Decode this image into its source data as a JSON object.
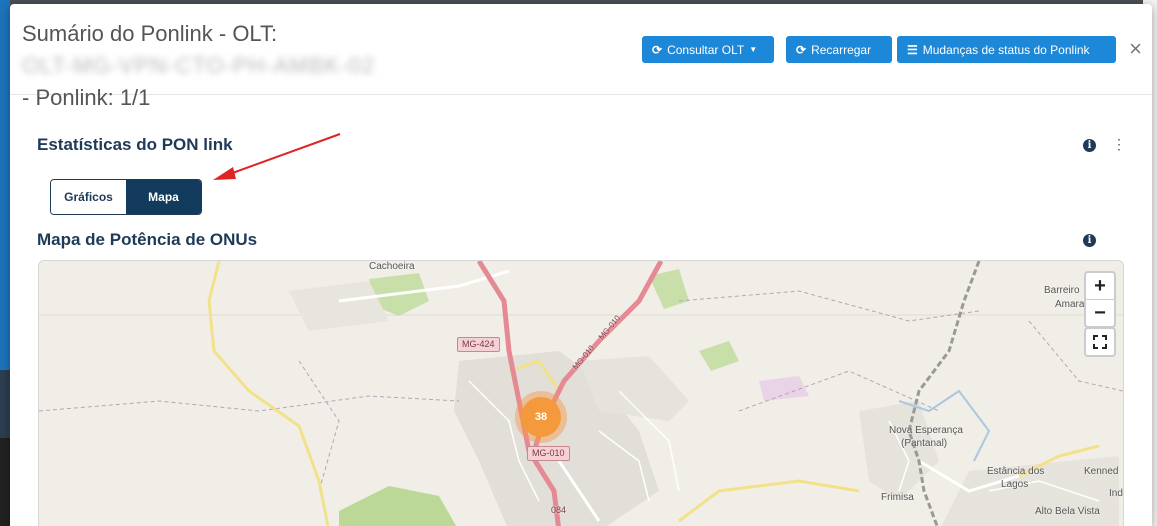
{
  "modal": {
    "title_prefix": "Sumário do Ponlink - OLT:",
    "olt_name": "OLT-MG-VPN-CTO-PH-AMBK-02",
    "title_suffix": "- Ponlink: 1/1",
    "buttons": {
      "consultar": "Consultar OLT",
      "recarregar": "Recarregar",
      "mudancas": "Mudanças de status do Ponlink"
    },
    "close_glyph": "×"
  },
  "stats": {
    "title": "Estatísticas do PON link",
    "tabs": [
      {
        "label": "Gráficos",
        "active": false
      },
      {
        "label": "Mapa",
        "active": true
      }
    ]
  },
  "map": {
    "title": "Mapa de Potência de ONUs",
    "cluster_count": "38",
    "zoom_in": "+",
    "zoom_out": "−",
    "places": {
      "cachoeira": "Cachoeira",
      "barreiro": "Barreiro",
      "amara": "Amara",
      "nova_esperanca": "Nova Esperança",
      "pantanal": "(Pantanal)",
      "estancia": "Estância dos",
      "lagos": "Lagos",
      "kennedy": "Kenned",
      "frimisa": "Frimisa",
      "alto_bela_vista": "Alto Bela Vista",
      "ind": "Ind"
    },
    "roads": {
      "mg424": "MG-424",
      "mg010_shield": "MG-010",
      "mg010_a": "MG-010",
      "mg010_b": "MG-010",
      "r084": "084"
    }
  },
  "colors": {
    "primary_button": "#1e88d8",
    "heading": "#1f3a57",
    "active_tab": "#123a5c",
    "cluster": "#f59a3c",
    "arrow": "#e02424"
  },
  "icons": {
    "refresh": "refresh-icon",
    "list": "list-icon",
    "info": "info-icon",
    "kebab": "kebab-menu-icon",
    "fullscreen": "fullscreen-icon",
    "close": "close-icon"
  }
}
